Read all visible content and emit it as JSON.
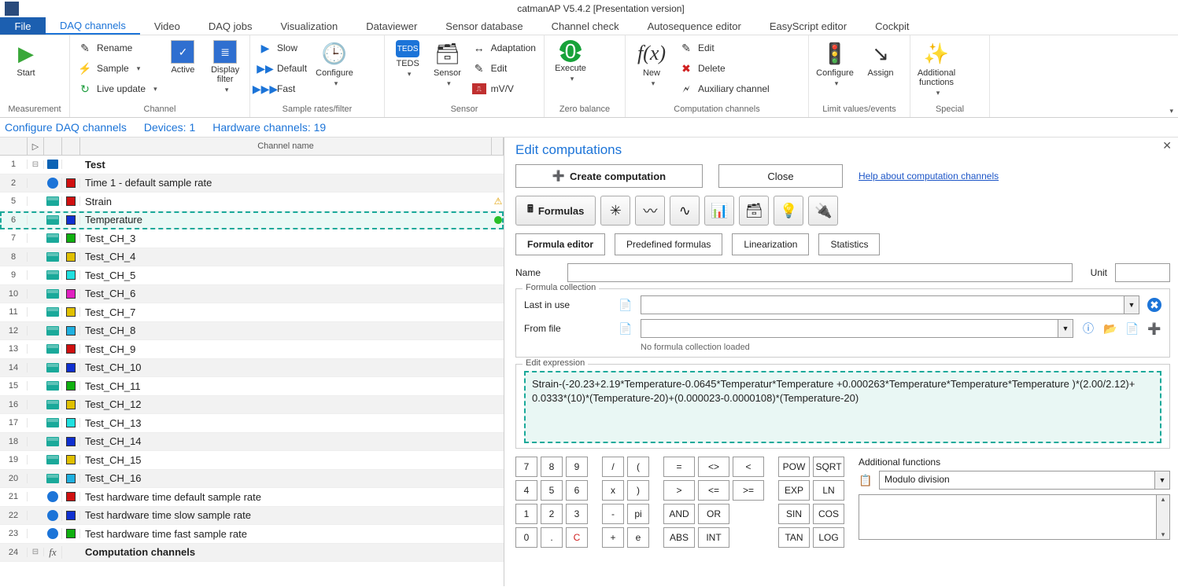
{
  "title": "catmanAP V5.4.2 [Presentation version]",
  "file_label": "File",
  "tabs": [
    "DAQ channels",
    "Video",
    "DAQ jobs",
    "Visualization",
    "Dataviewer",
    "Sensor database",
    "Channel check",
    "Autosequence editor",
    "EasyScript editor",
    "Cockpit"
  ],
  "active_tab": 0,
  "ribbon": {
    "measurement": {
      "label": "Measurement",
      "start": "Start"
    },
    "channel": {
      "label": "Channel",
      "rename": "Rename",
      "sample": "Sample",
      "live": "Live update",
      "active": "Active",
      "display": "Display\nfilter"
    },
    "rates": {
      "label": "Sample rates/filter",
      "slow": "Slow",
      "default": "Default",
      "fast": "Fast",
      "configure": "Configure"
    },
    "sensor": {
      "label": "Sensor",
      "teds": "TEDS",
      "sensorbtn": "Sensor",
      "adaptation": "Adaptation",
      "edit": "Edit",
      "mvv": "mV/V"
    },
    "zero": {
      "label": "Zero balance",
      "execute": "Execute"
    },
    "comp": {
      "label": "Computation channels",
      "new": "New",
      "fx": "f(x)",
      "edit": "Edit",
      "delete": "Delete",
      "aux": "Auxiliary channel"
    },
    "limits": {
      "label": "Limit values/events",
      "configure": "Configure",
      "assign": "Assign"
    },
    "special": {
      "label": "Special",
      "additional": "Additional\nfunctions"
    }
  },
  "info": {
    "a": "Configure DAQ channels",
    "b": "Devices: 1",
    "c": "Hardware channels: 19"
  },
  "grid_header": "Channel name",
  "channels": [
    {
      "n": 1,
      "exp": "⊟",
      "kind": "dev",
      "name": "Test",
      "head": true
    },
    {
      "n": 2,
      "kind": "clk",
      "sw": "#d01010",
      "name": "Time  1 - default sample rate"
    },
    {
      "n": 5,
      "kind": "sig",
      "sw": "#d01010",
      "name": "Strain",
      "warn": true
    },
    {
      "n": 6,
      "kind": "sig",
      "sw": "#1030d0",
      "name": "Temperature",
      "sel": true,
      "ok": true
    },
    {
      "n": 7,
      "kind": "sig",
      "sw": "#10b010",
      "name": "Test_CH_3"
    },
    {
      "n": 8,
      "kind": "sig",
      "sw": "#e0c000",
      "name": "Test_CH_4"
    },
    {
      "n": 9,
      "kind": "sig",
      "sw": "#20e0e0",
      "name": "Test_CH_5"
    },
    {
      "n": 10,
      "kind": "sig",
      "sw": "#e020c0",
      "name": "Test_CH_6"
    },
    {
      "n": 11,
      "kind": "sig",
      "sw": "#e0c000",
      "name": "Test_CH_7"
    },
    {
      "n": 12,
      "kind": "sig",
      "sw": "#20b0e0",
      "name": "Test_CH_8"
    },
    {
      "n": 13,
      "kind": "sig",
      "sw": "#d01010",
      "name": "Test_CH_9"
    },
    {
      "n": 14,
      "kind": "sig",
      "sw": "#1030d0",
      "name": "Test_CH_10"
    },
    {
      "n": 15,
      "kind": "sig",
      "sw": "#10b010",
      "name": "Test_CH_11"
    },
    {
      "n": 16,
      "kind": "sig",
      "sw": "#e0c000",
      "name": "Test_CH_12"
    },
    {
      "n": 17,
      "kind": "sig",
      "sw": "#20e0e0",
      "name": "Test_CH_13"
    },
    {
      "n": 18,
      "kind": "sig",
      "sw": "#1030d0",
      "name": "Test_CH_14"
    },
    {
      "n": 19,
      "kind": "sig",
      "sw": "#e0c000",
      "name": "Test_CH_15"
    },
    {
      "n": 20,
      "kind": "sig",
      "sw": "#20b0e0",
      "name": "Test_CH_16"
    },
    {
      "n": 21,
      "kind": "clk",
      "sw": "#d01010",
      "name": "Test hardware time default sample rate"
    },
    {
      "n": 22,
      "kind": "clk",
      "sw": "#1030d0",
      "name": "Test hardware time slow sample rate"
    },
    {
      "n": 23,
      "kind": "clk",
      "sw": "#10b010",
      "name": "Test hardware time fast sample rate"
    },
    {
      "n": 24,
      "exp": "⊟",
      "kind": "fx",
      "name": "Computation channels",
      "head": true
    }
  ],
  "edit": {
    "title": "Edit computations",
    "create": "Create computation",
    "close": "Close",
    "help": "Help about computation channels",
    "formulas": "Formulas",
    "tabs": [
      "Formula editor",
      "Predefined formulas",
      "Linearization",
      "Statistics"
    ],
    "name_lbl": "Name",
    "unit_lbl": "Unit",
    "coll": {
      "legend": "Formula collection",
      "last": "Last in use",
      "from": "From file",
      "note": "No formula collection loaded"
    },
    "expr_lbl": "Edit expression",
    "expr": "Strain-(-20.23+2.19*Temperature-0.0645*Temperatur*Temperature +0.000263*Temperature*Temperature*Temperature )*(2.00/2.12)+ 0.0333*(10)*(Temperature-20)+(0.000023-0.0000108)*(Temperature-20)",
    "keys_num": [
      [
        "7",
        "8",
        "9"
      ],
      [
        "4",
        "5",
        "6"
      ],
      [
        "1",
        "2",
        "3"
      ],
      [
        "0",
        ".",
        "C"
      ]
    ],
    "keys_op": [
      [
        "/",
        "("
      ],
      [
        "x",
        ")"
      ],
      [
        "-",
        "pi"
      ],
      [
        "+",
        "e"
      ]
    ],
    "keys_cmp": [
      [
        "=",
        "<>",
        "<"
      ],
      [
        ">",
        "<=",
        ">="
      ],
      [
        "AND",
        "OR"
      ],
      [
        "ABS",
        "INT"
      ]
    ],
    "keys_fn": [
      [
        "POW",
        "SQRT"
      ],
      [
        "EXP",
        "LN"
      ],
      [
        "SIN",
        "COS"
      ],
      [
        "TAN",
        "LOG"
      ]
    ],
    "af_lbl": "Additional functions",
    "af_sel": "Modulo division"
  }
}
